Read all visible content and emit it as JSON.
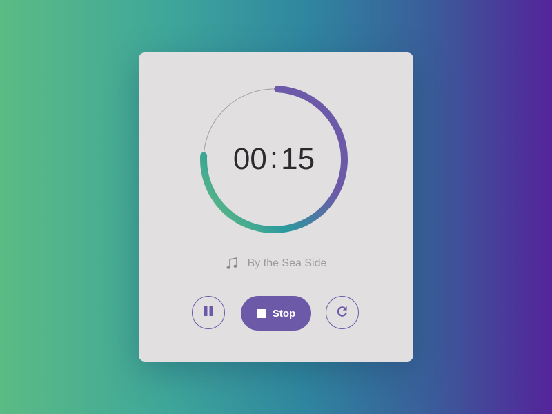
{
  "timer": {
    "minutes": "00",
    "separator": ":",
    "seconds": "15",
    "progress": 0.75
  },
  "track": {
    "icon": "music-note-icon",
    "title": "By the Sea Side"
  },
  "controls": {
    "pause_icon": "pause-icon",
    "stop_label": "Stop",
    "stop_icon": "stop-icon",
    "restart_icon": "restart-icon"
  },
  "colors": {
    "accent": "#6c5aa8",
    "ring_start": "#6fc37b",
    "ring_mid": "#2a9a9e",
    "ring_end": "#6c5aa8",
    "card_background": "#e1dfe0"
  }
}
